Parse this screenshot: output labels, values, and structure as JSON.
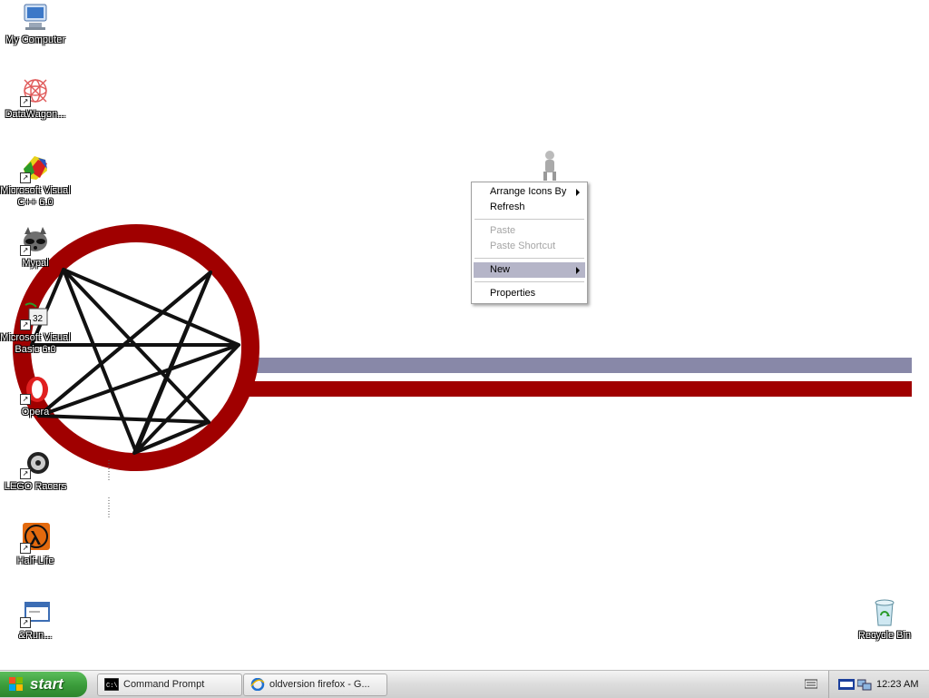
{
  "desktop_icons": [
    {
      "label": "My Computer",
      "icon": "my-computer-icon"
    },
    {
      "label": "DataWagon...",
      "icon": "datawagon-icon"
    },
    {
      "label": "Microsoft Visual C++ 6.0",
      "icon": "visual-cpp-icon"
    },
    {
      "label": "Mypal",
      "icon": "mypal-icon"
    },
    {
      "label": "Microsoft Visual Basic 6.0",
      "icon": "visual-basic-icon"
    },
    {
      "label": "Opera",
      "icon": "opera-icon"
    },
    {
      "label": "LEGO Racers",
      "icon": "lego-racers-icon"
    },
    {
      "label": "Half-Life",
      "icon": "half-life-icon"
    },
    {
      "label": "&Run...",
      "icon": "run-icon"
    },
    {
      "label": "Recycle Bin",
      "icon": "recycle-bin-icon"
    }
  ],
  "context_menu": {
    "items": [
      {
        "label": "Arrange Icons By",
        "submenu": true
      },
      {
        "label": "Refresh"
      },
      {
        "label": "Paste",
        "disabled": true
      },
      {
        "label": "Paste Shortcut",
        "disabled": true
      },
      {
        "label": "New",
        "submenu": true,
        "highlighted": true
      },
      {
        "label": "Properties"
      }
    ]
  },
  "taskbar": {
    "start_label": "start",
    "tasks": [
      {
        "label": "Command Prompt",
        "icon": "command-prompt-icon"
      },
      {
        "label": "oldversion firefox - G...",
        "icon": "internet-explorer-icon"
      }
    ],
    "clock": "12:23 AM"
  },
  "colors": {
    "wallpaper_red": "#a00000",
    "wallpaper_grey": "#8888a8",
    "start_green": "#3a9b3a",
    "menu_highlight": "#b5b5c8"
  }
}
